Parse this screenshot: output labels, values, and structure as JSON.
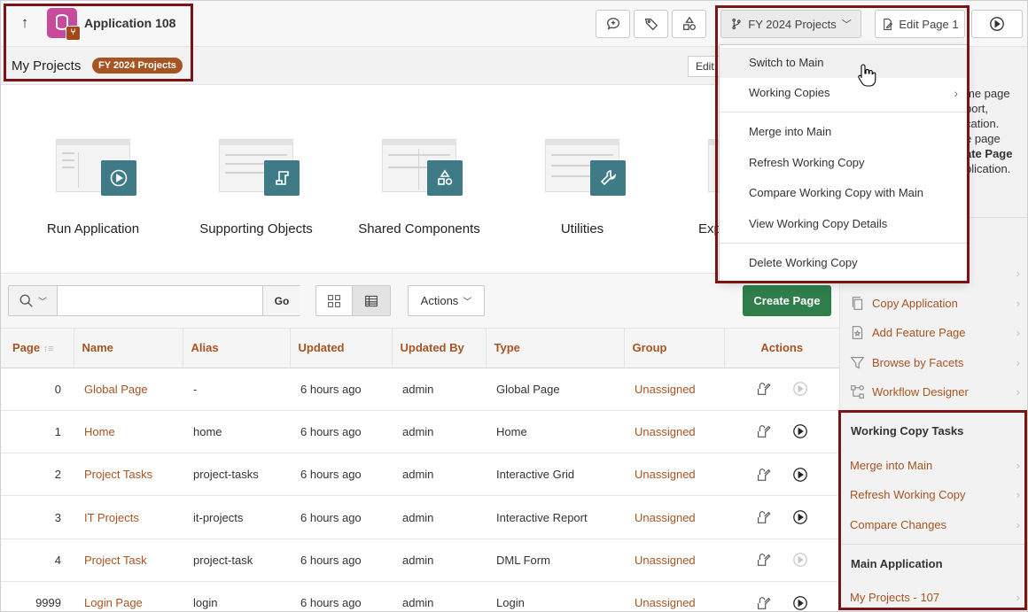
{
  "header": {
    "app_title": "Application 108",
    "branch_label": "FY 2024 Projects",
    "edit_page_label": "Edit Page 1"
  },
  "subheader": {
    "title": "My Projects",
    "badge": "FY 2024 Projects",
    "edit_label": "Edit"
  },
  "tiles": [
    {
      "label": "Run Application"
    },
    {
      "label": "Supporting Objects"
    },
    {
      "label": "Shared Components"
    },
    {
      "label": "Utilities"
    },
    {
      "label": "Exp"
    }
  ],
  "toolbar": {
    "search_value": "",
    "go_label": "Go",
    "actions_label": "Actions",
    "create_label": "Create Page"
  },
  "table": {
    "columns": [
      "Page",
      "Name",
      "Alias",
      "Updated",
      "Updated By",
      "Type",
      "Group",
      "Actions"
    ],
    "rows": [
      {
        "page": "0",
        "name": "Global Page",
        "alias": "-",
        "updated": "6 hours ago",
        "by": "admin",
        "type": "Global Page",
        "group": "Unassigned",
        "run_enabled": false
      },
      {
        "page": "1",
        "name": "Home",
        "alias": "home",
        "updated": "6 hours ago",
        "by": "admin",
        "type": "Home",
        "group": "Unassigned",
        "run_enabled": true
      },
      {
        "page": "2",
        "name": "Project Tasks",
        "alias": "project-tasks",
        "updated": "6 hours ago",
        "by": "admin",
        "type": "Interactive Grid",
        "group": "Unassigned",
        "run_enabled": true
      },
      {
        "page": "3",
        "name": "IT Projects",
        "alias": "it-projects",
        "updated": "6 hours ago",
        "by": "admin",
        "type": "Interactive Report",
        "group": "Unassigned",
        "run_enabled": true
      },
      {
        "page": "4",
        "name": "Project Task",
        "alias": "project-task",
        "updated": "6 hours ago",
        "by": "admin",
        "type": "DML Form",
        "group": "Unassigned",
        "run_enabled": false
      },
      {
        "page": "9999",
        "name": "Login Page",
        "alias": "login",
        "updated": "6 hours ago",
        "by": "admin",
        "type": "Login",
        "group": "Unassigned",
        "run_enabled": true
      }
    ]
  },
  "right_panel": {
    "partial_text_lines": [
      "me page",
      "port,",
      "cation.",
      "e page",
      "ate Page",
      "plication."
    ],
    "task_items": [
      {
        "label": "Copy Application",
        "icon": "copy-icon"
      },
      {
        "label": "Add Feature Page",
        "icon": "feature-page-icon"
      },
      {
        "label": "Browse by Facets",
        "icon": "filter-icon"
      },
      {
        "label": "Workflow Designer",
        "icon": "workflow-icon"
      }
    ],
    "working_copy_heading": "Working Copy Tasks",
    "working_copy_items": [
      {
        "label": "Merge into Main"
      },
      {
        "label": "Refresh Working Copy"
      },
      {
        "label": "Compare Changes"
      }
    ],
    "main_app_heading": "Main Application",
    "main_app_items": [
      {
        "label": "My Projects - 107"
      }
    ]
  },
  "dropdown": {
    "items": [
      {
        "label": "Switch to Main",
        "highlighted": true
      },
      {
        "label": "Working Copies",
        "has_submenu": true
      },
      {
        "label": "Merge into Main"
      },
      {
        "label": "Refresh Working Copy"
      },
      {
        "label": "Compare Working Copy with Main"
      },
      {
        "label": "View Working Copy Details"
      },
      {
        "label": "Delete Working Copy"
      }
    ]
  },
  "colors": {
    "accent": "#a75423",
    "teal": "#3f7b87",
    "create_green": "#2f7d4a",
    "highlight_border": "#7b1416"
  }
}
